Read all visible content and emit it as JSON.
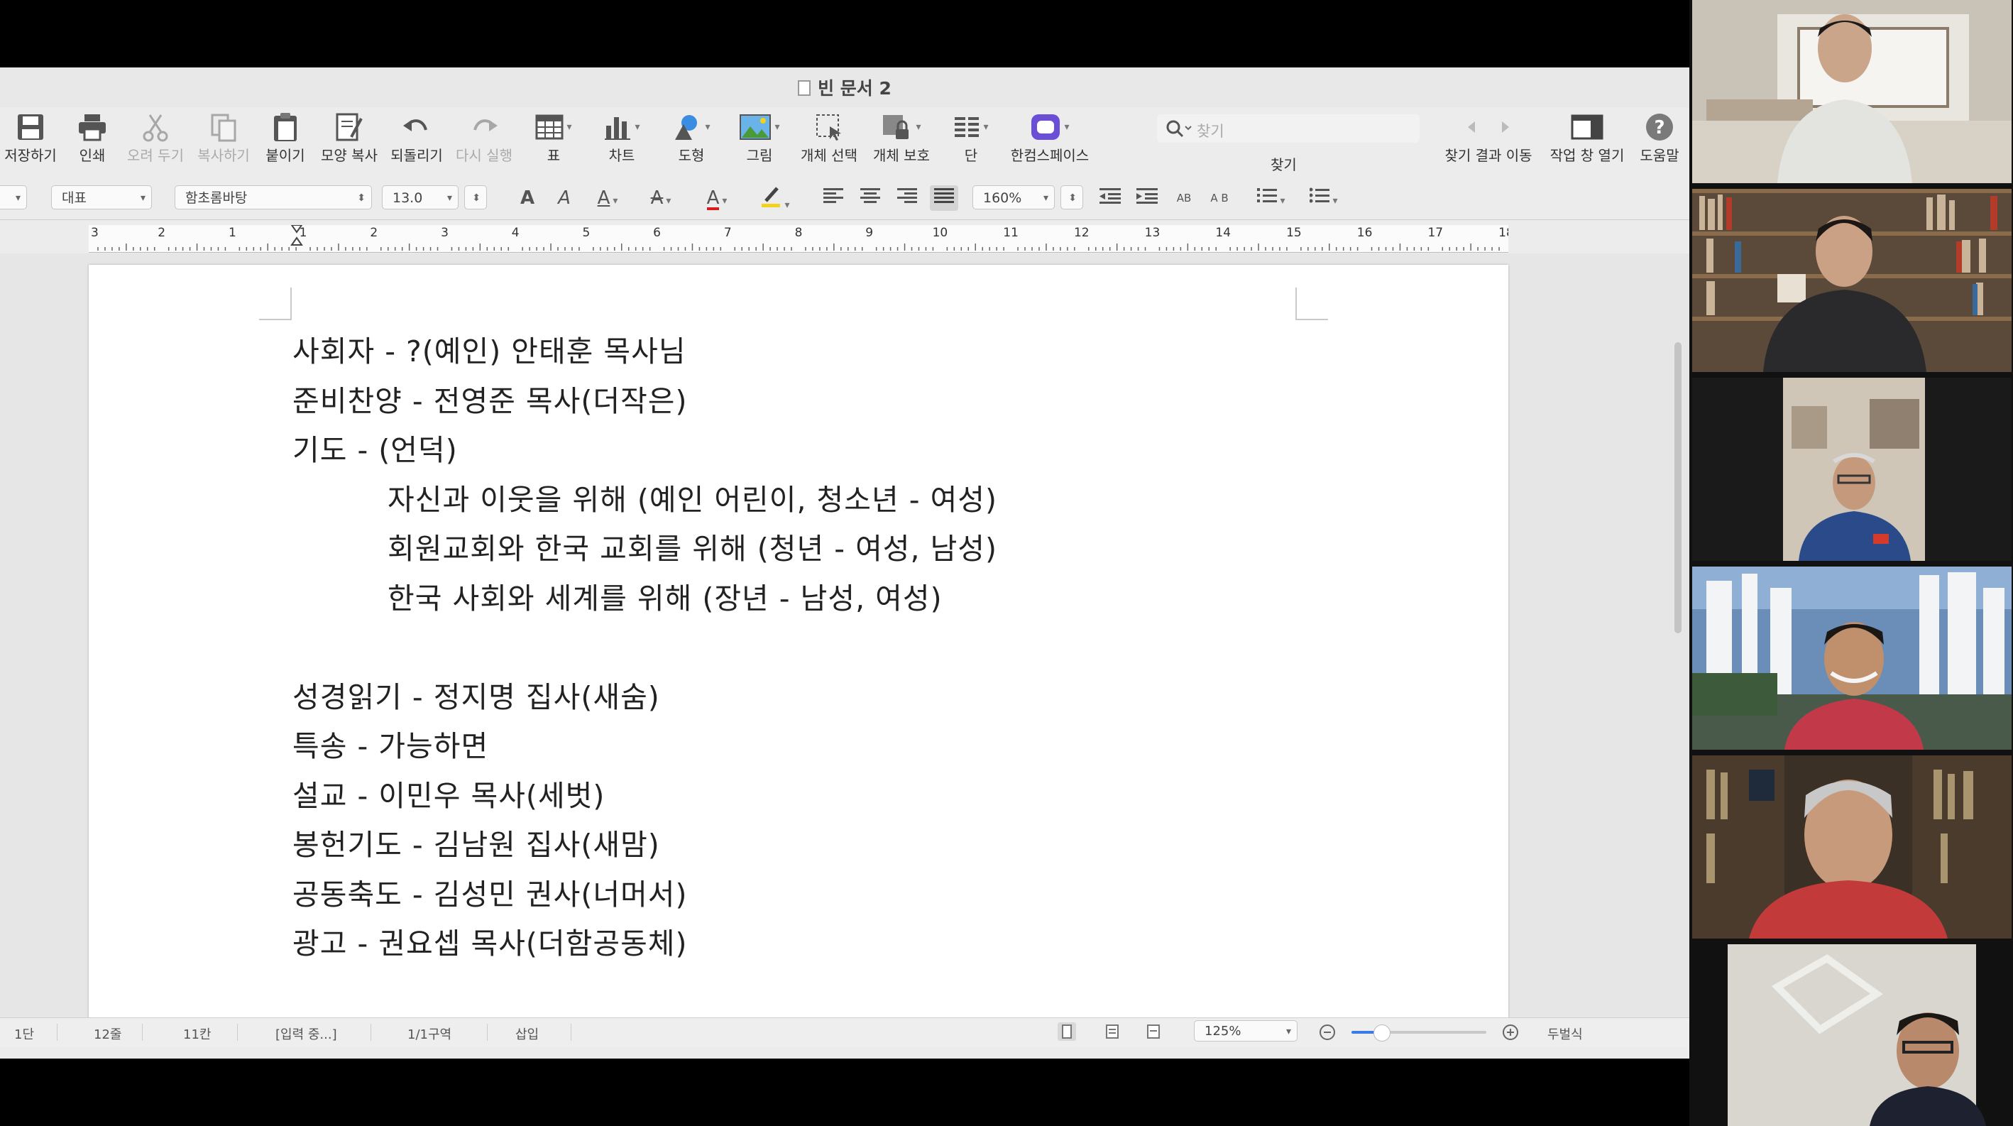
{
  "window": {
    "title": "빈 문서 2"
  },
  "toolbar": {
    "items": [
      {
        "label": "저장하기",
        "icon": "save-icon",
        "enabled": true
      },
      {
        "label": "인쇄",
        "icon": "print-icon",
        "enabled": true
      },
      {
        "label": "오려 두기",
        "icon": "cut-icon",
        "enabled": false
      },
      {
        "label": "복사하기",
        "icon": "copy-icon",
        "enabled": false
      },
      {
        "label": "붙이기",
        "icon": "paste-icon",
        "enabled": true
      },
      {
        "label": "모양 복사",
        "icon": "format-painter-icon",
        "enabled": true
      },
      {
        "label": "되돌리기",
        "icon": "undo-icon",
        "enabled": true
      },
      {
        "label": "다시 실행",
        "icon": "redo-icon",
        "enabled": false
      },
      {
        "label": "표",
        "icon": "table-icon",
        "enabled": true
      },
      {
        "label": "차트",
        "icon": "chart-icon",
        "enabled": true
      },
      {
        "label": "도형",
        "icon": "shape-icon",
        "enabled": true
      },
      {
        "label": "그림",
        "icon": "image-icon",
        "enabled": true
      },
      {
        "label": "개체 선택",
        "icon": "select-object-icon",
        "enabled": true
      },
      {
        "label": "개체 보호",
        "icon": "protect-object-icon",
        "enabled": true
      },
      {
        "label": "단",
        "icon": "columns-icon",
        "enabled": true
      },
      {
        "label": "한컴스페이스",
        "icon": "hancom-space-icon",
        "enabled": true
      }
    ],
    "search_placeholder": "찾기",
    "search_label": "찾기",
    "find_result_label": "찾기 결과 이동",
    "task_window_label": "작업 창 열기",
    "help_label": "도움말"
  },
  "formatbar": {
    "style": "대표",
    "font": "함초롬바탕",
    "size": "13.0",
    "line_spacing": "160%"
  },
  "ruler": {
    "labels": [
      "3",
      "2",
      "1",
      "1",
      "2",
      "3",
      "4",
      "5",
      "6",
      "7",
      "8",
      "9",
      "10",
      "11",
      "12",
      "13",
      "14",
      "15",
      "16",
      "17",
      "18"
    ]
  },
  "document": {
    "lines": [
      {
        "text": "사회자 - ?(예인) 안태훈 목사님",
        "indent": false
      },
      {
        "text": "준비찬양 - 전영준 목사(더작은)",
        "indent": false
      },
      {
        "text": "기도 - (언덕)",
        "indent": false
      },
      {
        "text": "자신과 이웃을 위해 (예인 어린이, 청소년 - 여성)",
        "indent": true
      },
      {
        "text": "회원교회와 한국 교회를 위해 (청년 - 여성, 남성)",
        "indent": true
      },
      {
        "text": "한국 사회와 세계를 위해 (장년 - 남성, 여성)",
        "indent": true
      },
      {
        "text": "",
        "indent": false
      },
      {
        "text": "성경읽기 - 정지명 집사(새숨)",
        "indent": false
      },
      {
        "text": "특송 - 가능하면",
        "indent": false
      },
      {
        "text": "설교 - 이민우 목사(세벗)",
        "indent": false
      },
      {
        "text": "봉헌기도 - 김남원 집사(새맘)",
        "indent": false
      },
      {
        "text": "공동축도 - 김성민 권사(너머서)",
        "indent": false
      },
      {
        "text": "광고 - 권요셉 목사(더함공동체)",
        "indent": false
      }
    ]
  },
  "statusbar": {
    "section": "1단",
    "line": "12줄",
    "column": "11칸",
    "mode": "[입력 중...]",
    "area": "1/1구역",
    "insert": "삽입",
    "zoom": "125%",
    "zoom_level": 0.22,
    "view_mode": "두벌식"
  },
  "colors": {
    "font_color": "#d81b1b",
    "highlight_color": "#f2d21b",
    "hancom_space": "#6a4fd6"
  },
  "participants": [
    {
      "name": "participant-1"
    },
    {
      "name": "participant-2"
    },
    {
      "name": "participant-3"
    },
    {
      "name": "participant-4"
    },
    {
      "name": "participant-5"
    },
    {
      "name": "participant-6"
    }
  ]
}
